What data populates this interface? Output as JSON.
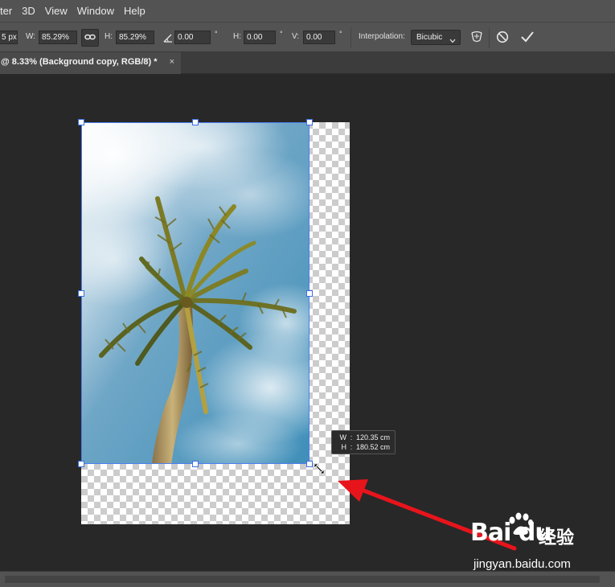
{
  "menu": {
    "items": [
      "ter",
      "3D",
      "View",
      "Window",
      "Help"
    ]
  },
  "options": {
    "x_partial": "5 px",
    "w_label": "W:",
    "w_value": "85.29%",
    "h_label": "H:",
    "h_value": "85.29%",
    "angle_value": "0.00",
    "angle_unit": "°",
    "skew_h_label": "H:",
    "skew_h_value": "0.00",
    "skew_h_unit": "°",
    "skew_v_label": "V:",
    "skew_v_value": "0.00",
    "skew_v_unit": "°",
    "interp_label": "Interpolation:",
    "interp_value": "Bicubic"
  },
  "tab": {
    "title": "@ 8.33% (Background copy, RGB/8) *",
    "close": "×"
  },
  "tooltip": {
    "w_key": "W",
    "w_value": "120.35 cm",
    "h_key": "H",
    "h_value": "180.52 cm",
    "sep": ":"
  },
  "watermark": {
    "brand": "Bai du",
    "chinese": "经验",
    "url": "jingyan.baidu.com"
  },
  "colors": {
    "selection_outline": "#4d7ef0",
    "annotation_arrow": "#e8141c",
    "ui_panel": "#535353",
    "canvas_bg": "#282828"
  },
  "icons": [
    "link-icon",
    "angle-icon",
    "warp-icon",
    "cancel-icon",
    "commit-icon",
    "resize-cursor-icon",
    "paw-icon"
  ]
}
